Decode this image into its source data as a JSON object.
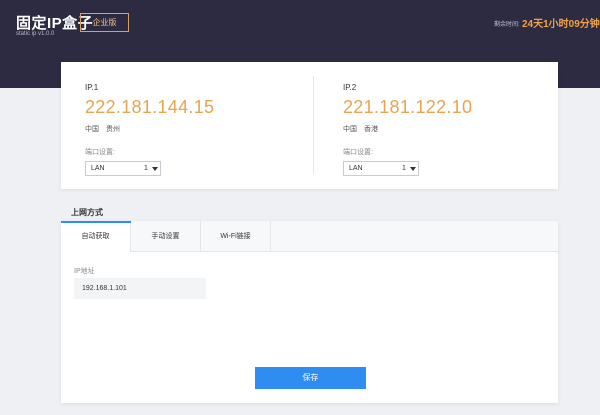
{
  "header": {
    "title": "固定IP盒子",
    "version": "static ip v1.0.0",
    "edition_label": "企业版",
    "remaining_label": "剩余时间:",
    "remaining_value": "24天1小时09分钟"
  },
  "ips": [
    {
      "name": "IP.1",
      "address": "222.181.144.15",
      "country": "中国",
      "region": "贵州",
      "port_label": "端口设置:",
      "port_type": "LAN",
      "port_number": "1"
    },
    {
      "name": "IP.2",
      "address": "221.181.122.10",
      "country": "中国",
      "region": "香港",
      "port_label": "端口设置:",
      "port_type": "LAN",
      "port_number": "1"
    }
  ],
  "network": {
    "section_title": "上网方式",
    "tabs": [
      "自动获取",
      "手动设置",
      "Wi-Fi链接"
    ],
    "ip_label": "IP地址",
    "ip_value": "192.168.1.101",
    "save_label": "保存"
  },
  "colors": {
    "header_bg": "#2c2b42",
    "accent_orange": "#e8a451",
    "primary_blue": "#2f8cf0"
  }
}
